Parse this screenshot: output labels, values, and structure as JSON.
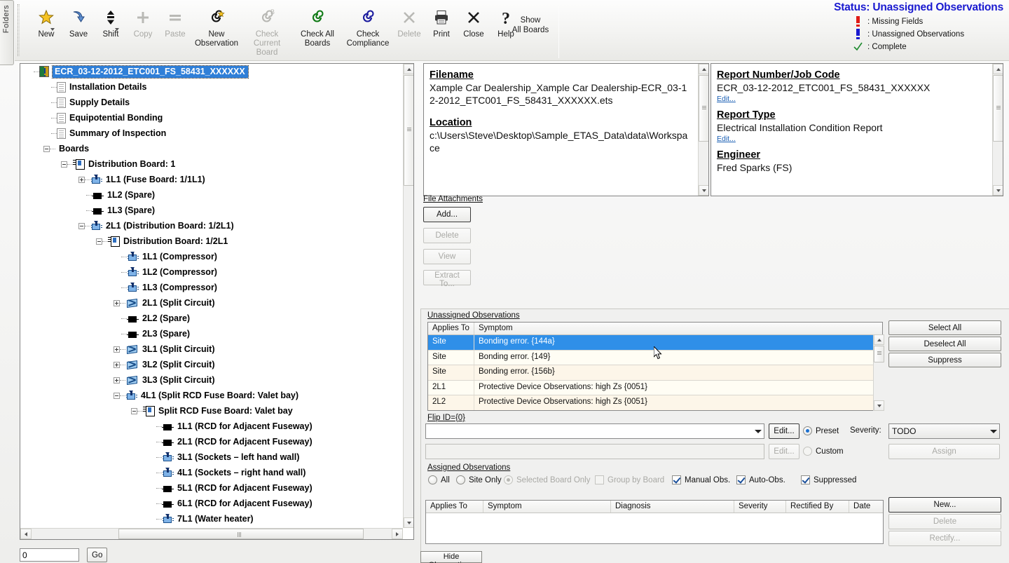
{
  "folders_tab": {
    "label": "Folders"
  },
  "toolbar": {
    "buttons": [
      {
        "label": "New",
        "icon": "star-icon",
        "disabled": false,
        "dropdown": true
      },
      {
        "label": "Save",
        "icon": "save-arrow-icon",
        "disabled": false,
        "dropdown": false
      },
      {
        "label": "Shift",
        "icon": "updown-arrows-icon",
        "disabled": false,
        "dropdown": true
      },
      {
        "label": "Copy",
        "icon": "plus-icon",
        "disabled": true,
        "dropdown": false
      },
      {
        "label": "Paste",
        "icon": "equals-icon",
        "disabled": true,
        "dropdown": false
      },
      {
        "label": "New\nObservation",
        "icon": "spiral-star-icon",
        "disabled": false,
        "dropdown": false
      },
      {
        "label": "Check Current\nBoard",
        "icon": "spiral-b-icon",
        "disabled": true,
        "dropdown": false
      },
      {
        "label": "Check All\nBoards",
        "icon": "spiral-green-icon",
        "disabled": false,
        "dropdown": false
      },
      {
        "label": "Check\nCompliance",
        "icon": "spiral-blue-icon",
        "disabled": false,
        "dropdown": false
      },
      {
        "label": "Delete",
        "icon": "x-icon",
        "disabled": true,
        "dropdown": false
      },
      {
        "label": "Print",
        "icon": "printer-icon",
        "disabled": false,
        "dropdown": false
      },
      {
        "label": "Close",
        "icon": "x-icon",
        "disabled": false,
        "dropdown": false
      },
      {
        "label": "Help",
        "icon": "question-mark-icon",
        "disabled": false,
        "dropdown": false
      }
    ],
    "show_all_boards": "Show\nAll Boards"
  },
  "status": {
    "title": "Status: Unassigned Observations",
    "title_color": "#1a1ad0",
    "legend": [
      {
        "icon": "red-exclamation-icon",
        "color": "#e01b16",
        "text": ": Missing Fields"
      },
      {
        "icon": "blue-exclamation-icon",
        "color": "#1a1ad0",
        "text": ": Unassigned Observations"
      },
      {
        "icon": "green-check-icon",
        "color": "#1d8a2e",
        "text": ": Complete"
      }
    ]
  },
  "tree": {
    "nodes": [
      {
        "label": "ECR_03-12-2012_ETC001_FS_58431_XXXXXX",
        "depth": 0,
        "icon": "project-root-icon",
        "expander": "none",
        "selected": true
      },
      {
        "label": "Installation Details",
        "depth": 1,
        "icon": "document-icon",
        "expander": "none",
        "selected": false
      },
      {
        "label": "Supply Details",
        "depth": 1,
        "icon": "document-icon",
        "expander": "none",
        "selected": false
      },
      {
        "label": "Equipotential Bonding",
        "depth": 1,
        "icon": "document-icon",
        "expander": "none",
        "selected": false
      },
      {
        "label": "Summary of Inspection",
        "depth": 1,
        "icon": "document-icon",
        "expander": "none",
        "selected": false
      },
      {
        "label": "Boards",
        "depth": 1,
        "icon": "none",
        "expander": "minus",
        "selected": false
      },
      {
        "label": "Distribution Board: 1",
        "depth": 2,
        "icon": "board-icon",
        "expander": "minus",
        "selected": false
      },
      {
        "label": "1L1 (Fuse Board: 1/1L1)",
        "depth": 3,
        "icon": "circuit-icon",
        "expander": "plus",
        "selected": false
      },
      {
        "label": "1L2 (Spare)",
        "depth": 3,
        "icon": "spare-icon",
        "expander": "none",
        "selected": false
      },
      {
        "label": "1L3 (Spare)",
        "depth": 3,
        "icon": "spare-icon",
        "expander": "none",
        "selected": false
      },
      {
        "label": "2L1 (Distribution Board: 1/2L1)",
        "depth": 3,
        "icon": "circuit-icon",
        "expander": "minus",
        "selected": false
      },
      {
        "label": "Distribution Board: 1/2L1",
        "depth": 4,
        "icon": "board-icon",
        "expander": "minus",
        "selected": false
      },
      {
        "label": "1L1 (Compressor)",
        "depth": 5,
        "icon": "circuit-icon",
        "expander": "none",
        "selected": false
      },
      {
        "label": "1L2 (Compressor)",
        "depth": 5,
        "icon": "circuit-icon",
        "expander": "none",
        "selected": false
      },
      {
        "label": "1L3 (Compressor)",
        "depth": 5,
        "icon": "circuit-icon",
        "expander": "none",
        "selected": false
      },
      {
        "label": "2L1 (Split Circuit)",
        "depth": 5,
        "icon": "split-circuit-icon",
        "expander": "plus",
        "selected": false
      },
      {
        "label": "2L2 (Spare)",
        "depth": 5,
        "icon": "spare-icon",
        "expander": "none",
        "selected": false
      },
      {
        "label": "2L3 (Spare)",
        "depth": 5,
        "icon": "spare-icon",
        "expander": "none",
        "selected": false
      },
      {
        "label": "3L1 (Split Circuit)",
        "depth": 5,
        "icon": "split-circuit-icon",
        "expander": "plus",
        "selected": false
      },
      {
        "label": "3L2 (Split Circuit)",
        "depth": 5,
        "icon": "split-circuit-icon",
        "expander": "plus",
        "selected": false
      },
      {
        "label": "3L3 (Split Circuit)",
        "depth": 5,
        "icon": "split-circuit-icon",
        "expander": "plus",
        "selected": false
      },
      {
        "label": "4L1 (Split RCD Fuse Board: Valet bay)",
        "depth": 5,
        "icon": "circuit-icon",
        "expander": "minus",
        "selected": false
      },
      {
        "label": "Split RCD Fuse Board: Valet bay",
        "depth": 6,
        "icon": "board-icon",
        "expander": "minus",
        "selected": false
      },
      {
        "label": "1L1 (RCD for Adjacent Fuseway)",
        "depth": 7,
        "icon": "spare-icon",
        "expander": "none",
        "selected": false
      },
      {
        "label": "2L1 (RCD for Adjacent Fuseway)",
        "depth": 7,
        "icon": "spare-icon",
        "expander": "none",
        "selected": false
      },
      {
        "label": "3L1 (Sockets – left hand wall)",
        "depth": 7,
        "icon": "circuit-icon",
        "expander": "none",
        "selected": false
      },
      {
        "label": "4L1 (Sockets – right hand wall)",
        "depth": 7,
        "icon": "circuit-icon",
        "expander": "none",
        "selected": false
      },
      {
        "label": "5L1 (RCD for Adjacent Fuseway)",
        "depth": 7,
        "icon": "spare-icon",
        "expander": "none",
        "selected": false
      },
      {
        "label": "6L1 (RCD for Adjacent Fuseway)",
        "depth": 7,
        "icon": "spare-icon",
        "expander": "none",
        "selected": false
      },
      {
        "label": "7L1 (Water heater)",
        "depth": 7,
        "icon": "circuit-icon",
        "expander": "none",
        "selected": false
      }
    ]
  },
  "goto": {
    "value": "0",
    "button": "Go"
  },
  "info_left": {
    "filename_header": "Filename",
    "filename_value": "Xample Car Dealership_Xample Car Dealership-ECR_03-12-2012_ETC001_FS_58431_XXXXXX.ets",
    "location_header": "Location",
    "location_value": "c:\\Users\\Steve\\Desktop\\Sample_ETAS_Data\\data\\Workspace"
  },
  "info_right": {
    "report_number_header": "Report Number/Job Code",
    "report_number_value": "ECR_03-12-2012_ETC001_FS_58431_XXXXXX",
    "report_number_edit": "Edit...",
    "report_type_header": "Report Type",
    "report_type_value": "Electrical Installation Condition Report",
    "report_type_edit": "Edit...",
    "engineer_header": "Engineer",
    "engineer_value": "Fred Sparks (FS)"
  },
  "attachments": {
    "label": "File Attachments",
    "buttons": [
      {
        "label": "Add...",
        "disabled": false,
        "primary": true
      },
      {
        "label": "Delete",
        "disabled": true,
        "primary": false
      },
      {
        "label": "View",
        "disabled": true,
        "primary": false
      },
      {
        "label": "Extract To...",
        "disabled": true,
        "primary": false
      }
    ]
  },
  "unassigned": {
    "label": "Unassigned Observations",
    "columns": [
      "Applies To",
      "Symptom"
    ],
    "rows": [
      {
        "applies_to": "Site",
        "symptom": "Bonding error. {144a}",
        "selected": true
      },
      {
        "applies_to": "Site",
        "symptom": "Bonding error. {149}",
        "selected": false
      },
      {
        "applies_to": "Site",
        "symptom": "Bonding error. {156b}",
        "selected": false
      },
      {
        "applies_to": "2L1",
        "symptom": "Protective Device Observations: high Zs {0051}",
        "selected": false
      },
      {
        "applies_to": "2L2",
        "symptom": "Protective Device Observations: high Zs {0051}",
        "selected": false
      }
    ],
    "buttons": [
      {
        "label": "Select All",
        "disabled": false
      },
      {
        "label": "Deselect All",
        "disabled": false
      },
      {
        "label": "Suppress",
        "disabled": false
      }
    ]
  },
  "diagnosis": {
    "flip_id_label": "Flip ID={0}",
    "preset_value": "",
    "custom_value": "",
    "preset_edit": "Edit...",
    "custom_edit": "Edit...",
    "preset_label": "Preset",
    "custom_label": "Custom",
    "preset_selected": true,
    "severity_label": "Severity:",
    "severity_value": "TODO",
    "assign_label": "Assign",
    "assign_disabled": true
  },
  "assigned": {
    "label": "Assigned Observations",
    "filters": [
      {
        "type": "radio",
        "label": "All",
        "checked": false,
        "disabled": false
      },
      {
        "type": "radio",
        "label": "Site Only",
        "checked": false,
        "disabled": false
      },
      {
        "type": "radio",
        "label": "Selected Board Only",
        "checked": true,
        "disabled": true
      },
      {
        "type": "checkbox",
        "label": "Group by Board",
        "checked": false,
        "disabled": true
      },
      {
        "type": "checkbox",
        "label": "Manual Obs.",
        "checked": true,
        "disabled": false
      },
      {
        "type": "checkbox",
        "label": "Auto-Obs.",
        "checked": true,
        "disabled": false
      },
      {
        "type": "checkbox",
        "label": "Suppressed",
        "checked": true,
        "disabled": false
      }
    ],
    "columns": [
      "Applies To",
      "Symptom",
      "Diagnosis",
      "Severity",
      "Rectified By",
      "Date"
    ],
    "rows": [],
    "buttons": [
      {
        "label": "New...",
        "disabled": false,
        "primary": true
      },
      {
        "label": "Delete",
        "disabled": true,
        "primary": false
      },
      {
        "label": "Rectify...",
        "disabled": true,
        "primary": false
      }
    ]
  },
  "footer": {
    "hide_observations": "Hide Observations"
  }
}
